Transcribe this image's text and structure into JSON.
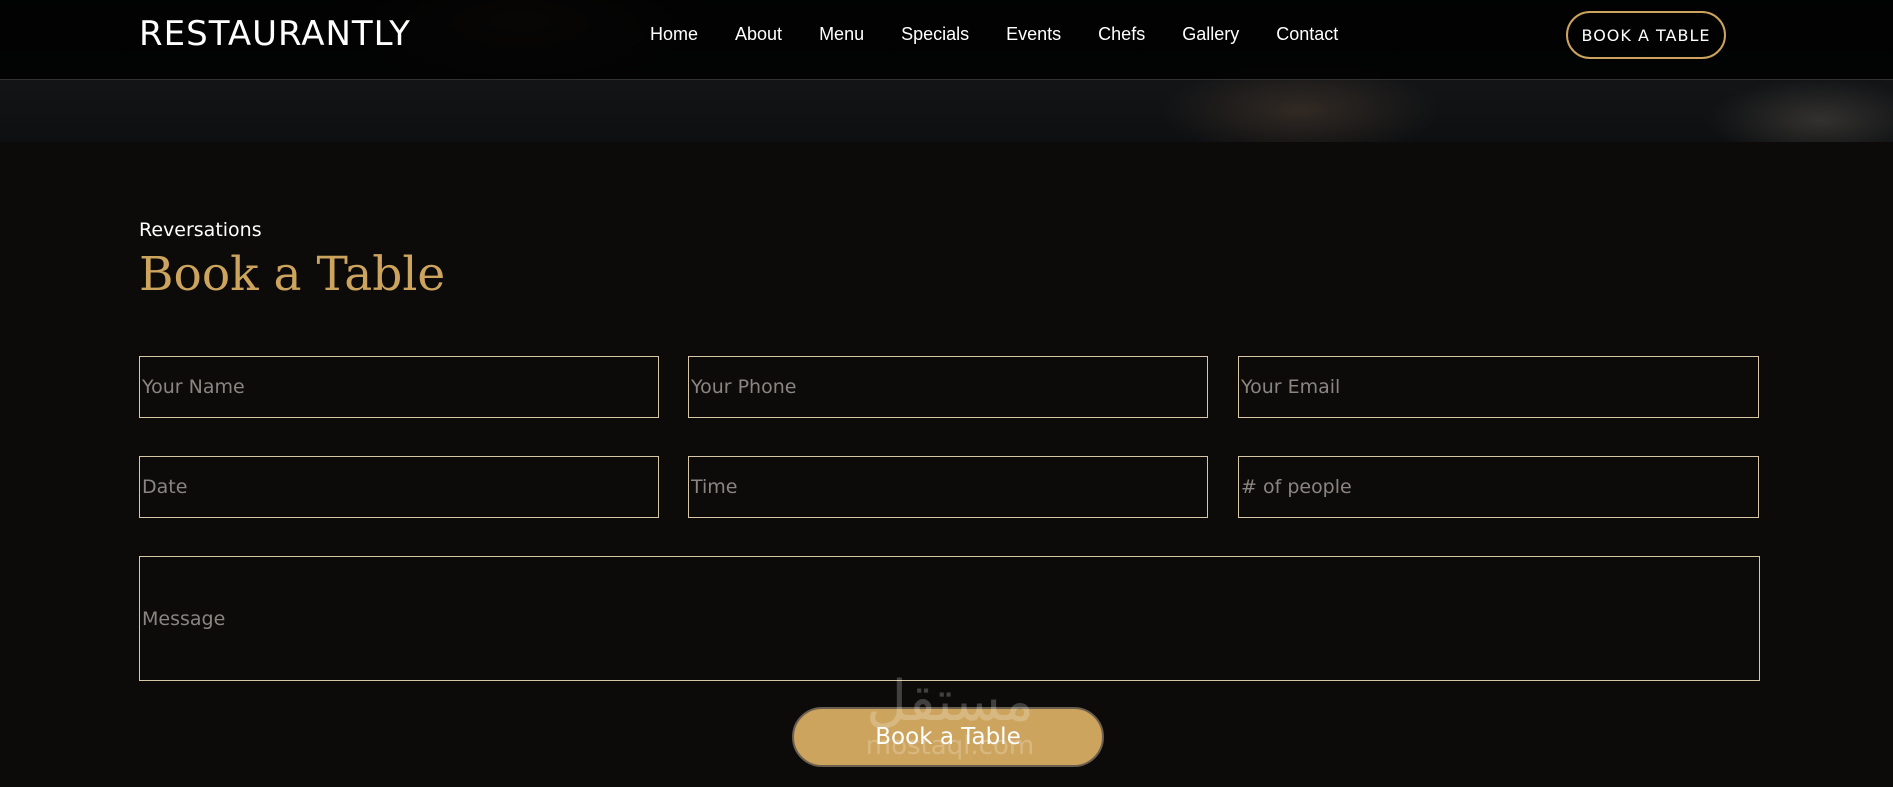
{
  "header": {
    "logo": "RESTAURANTLY",
    "nav": [
      "Home",
      "About",
      "Menu",
      "Specials",
      "Events",
      "Chefs",
      "Gallery",
      "Contact"
    ],
    "cta_label": "BOOK A TABLE"
  },
  "section": {
    "eyebrow": "Reversations",
    "title": "Book a Table"
  },
  "form": {
    "name_placeholder": "Your Name",
    "phone_placeholder": "Your Phone",
    "email_placeholder": "Your Email",
    "date_placeholder": "Date",
    "time_placeholder": "Time",
    "people_placeholder": "# of people",
    "message_placeholder": "Message",
    "submit_label": "Book a Table"
  },
  "watermark": {
    "arabic": "مستقل",
    "latin": "mostaql.com"
  },
  "colors": {
    "accent": "#cda45e",
    "background": "#0c0b09",
    "field_border": "#d8c7a4"
  }
}
